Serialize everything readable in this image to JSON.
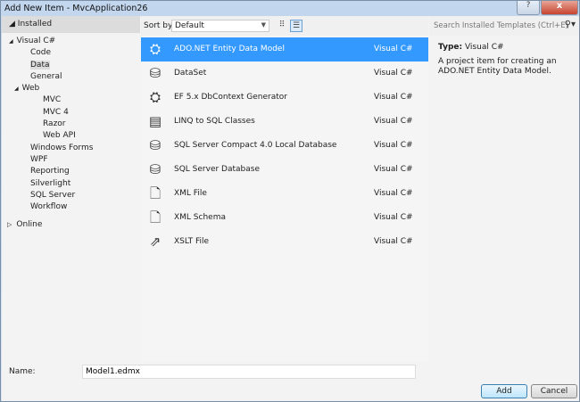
{
  "window": {
    "title": "Add New Item - MvcApplication26",
    "help": "?",
    "close": "x"
  },
  "left": {
    "header": "Installed",
    "tree": [
      {
        "label": "Visual C#",
        "level": 0,
        "arrow": "◢"
      },
      {
        "label": "Code",
        "level": 2
      },
      {
        "label": "Data",
        "level": 2,
        "selected": true
      },
      {
        "label": "General",
        "level": 2
      },
      {
        "label": "Web",
        "level": 1,
        "arrow": "◢"
      },
      {
        "label": "MVC",
        "level": 3
      },
      {
        "label": "MVC 4",
        "level": 3
      },
      {
        "label": "Razor",
        "level": 3
      },
      {
        "label": "Web API",
        "level": 3
      },
      {
        "label": "Windows Forms",
        "level": 2
      },
      {
        "label": "WPF",
        "level": 2
      },
      {
        "label": "Reporting",
        "level": 2
      },
      {
        "label": "Silverlight",
        "level": 2
      },
      {
        "label": "SQL Server",
        "level": 2
      },
      {
        "label": "Workflow",
        "level": 2
      }
    ],
    "online": "Online"
  },
  "toolbar": {
    "sort_label": "Sort by:",
    "sort_value": "Default"
  },
  "items": [
    {
      "name": "ADO.NET Entity Data Model",
      "lang": "Visual C#",
      "icon": "entity-model-icon",
      "glyph": "⛭"
    },
    {
      "name": "DataSet",
      "lang": "Visual C#",
      "icon": "dataset-icon",
      "glyph": "⛁"
    },
    {
      "name": "EF 5.x DbContext Generator",
      "lang": "Visual C#",
      "icon": "dbcontext-generator-icon",
      "glyph": "⛭"
    },
    {
      "name": "LINQ to SQL Classes",
      "lang": "Visual C#",
      "icon": "linq-classes-icon",
      "glyph": "▤"
    },
    {
      "name": "SQL Server Compact 4.0 Local Database",
      "lang": "Visual C#",
      "icon": "database-icon",
      "glyph": "⛁"
    },
    {
      "name": "SQL Server Database",
      "lang": "Visual C#",
      "icon": "database-icon",
      "glyph": "⛁"
    },
    {
      "name": "XML File",
      "lang": "Visual C#",
      "icon": "xml-file-icon",
      "glyph": "🗋"
    },
    {
      "name": "XML Schema",
      "lang": "Visual C#",
      "icon": "xml-schema-icon",
      "glyph": "🗋"
    },
    {
      "name": "XSLT File",
      "lang": "Visual C#",
      "icon": "xslt-file-icon",
      "glyph": "⇗"
    }
  ],
  "details": {
    "search_placeholder": "Search Installed Templates (Ctrl+E)",
    "type_label": "Type:",
    "type_value": "Visual C#",
    "description": "A project item for creating an ADO.NET Entity Data Model."
  },
  "footer": {
    "name_label": "Name:",
    "name_value": "Model1.edmx",
    "add": "Add",
    "cancel": "Cancel"
  }
}
